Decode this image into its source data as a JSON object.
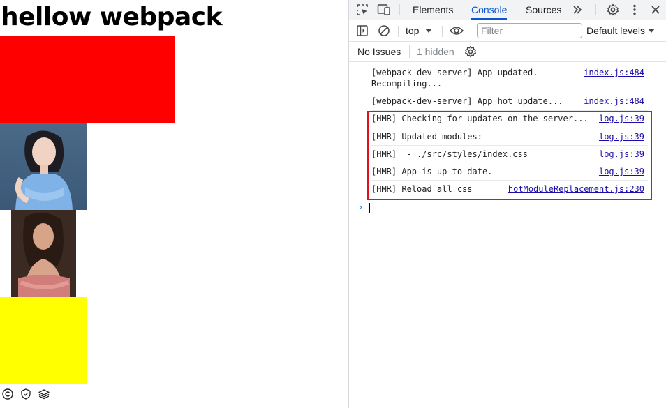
{
  "page": {
    "heading": "hellow webpack",
    "red_box_color": "#ff0000",
    "yellow_box_color": "#ffff00",
    "ext_icons": [
      "copyright-icon",
      "shield-icon",
      "layers-icon"
    ]
  },
  "devtools": {
    "tabs": [
      {
        "label": "Elements",
        "active": false
      },
      {
        "label": "Console",
        "active": true
      },
      {
        "label": "Sources",
        "active": false
      }
    ],
    "toolbar": {
      "context": "top",
      "filter_placeholder": "Filter",
      "levels": "Default levels"
    },
    "issues": {
      "no_issues": "No Issues",
      "hidden": "1 hidden"
    },
    "messages": [
      {
        "text": "[webpack-dev-server] App updated.\nRecompiling...",
        "source": "index.js:484"
      },
      {
        "text": "[webpack-dev-server] App hot update...",
        "source": "index.js:484"
      },
      {
        "text": "[HMR] Checking for updates on the server...",
        "source": "log.js:39"
      },
      {
        "text": "[HMR] Updated modules:",
        "source": "log.js:39"
      },
      {
        "text": "[HMR]  - ./src/styles/index.css",
        "source": "log.js:39"
      },
      {
        "text": "[HMR] App is up to date.",
        "source": "log.js:39"
      },
      {
        "text": "[HMR] Reload all css",
        "source": "hotModuleReplacement.js:230"
      }
    ],
    "prompt": "›",
    "accent_color": "#0b57d0",
    "highlight_color": "#e0101e"
  }
}
